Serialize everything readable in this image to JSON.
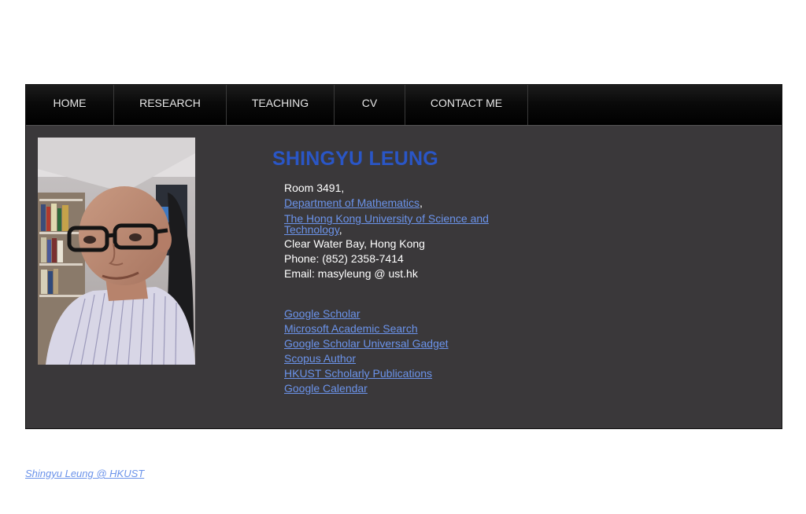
{
  "nav": {
    "items": [
      {
        "label": "HOME"
      },
      {
        "label": "RESEARCH"
      },
      {
        "label": "TEACHING"
      },
      {
        "label": "CV"
      },
      {
        "label": "CONTACT ME"
      }
    ]
  },
  "profile": {
    "name": "SHINGYU LEUNG",
    "room": "Room 3491,",
    "department_link": "Department of Mathematics",
    "university_link": "The Hong Kong University of Science and Technology",
    "comma": ",",
    "address": "Clear Water Bay, Hong Kong",
    "phone": "Phone: (852) 2358-7414",
    "email": "Email: masyleung @ ust.hk"
  },
  "links": [
    {
      "label": "Google Scholar"
    },
    {
      "label": "Microsoft Academic Search"
    },
    {
      "label": "Google Scholar Universal Gadget"
    },
    {
      "label": "Scopus Author"
    },
    {
      "label": "HKUST Scholarly Publications"
    },
    {
      "label": "Google Calendar"
    }
  ],
  "footer": {
    "text": "Shingyu Leung @ HKUST"
  },
  "colors": {
    "content_bg": "#3a383a",
    "nav_bg": "#000000",
    "name_blue": "#2a56c6",
    "link_blue": "#6b93ea"
  }
}
